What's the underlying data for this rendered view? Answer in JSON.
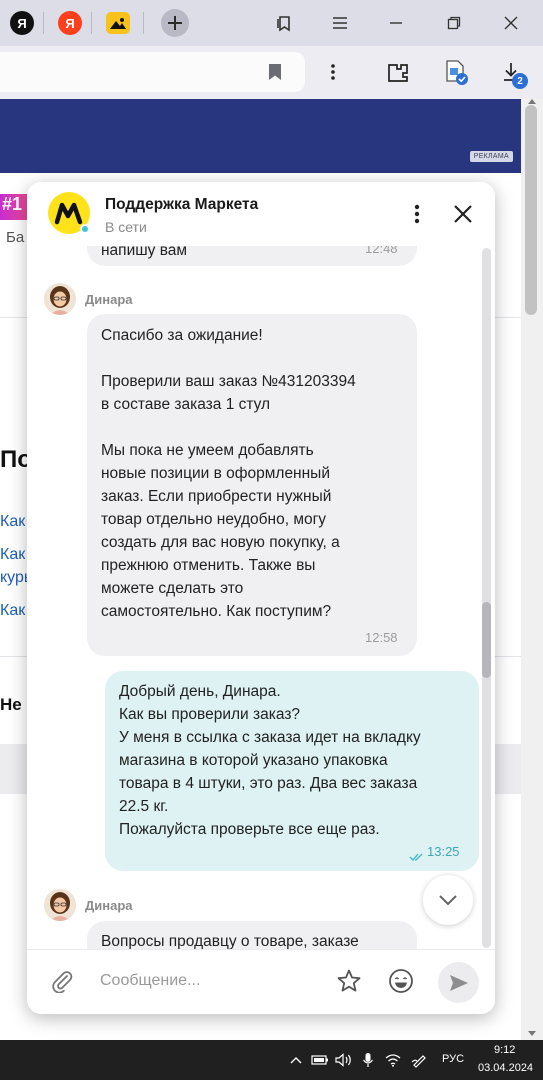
{
  "browser": {
    "tabs": [
      {
        "icon": "yandex-icon",
        "label": "Я",
        "bg": "#111111",
        "fg": "#ffffff"
      },
      {
        "icon": "yandex-browser-icon",
        "label": "Я",
        "bg": "#fc3f1d",
        "fg": "#ffffff"
      },
      {
        "icon": "image-icon",
        "label": "",
        "bg": "#f7c21a",
        "fg": "#000000"
      }
    ]
  },
  "chat": {
    "title": "Поддержка Маркета",
    "status": "В сети",
    "input_placeholder": "Сообщение...",
    "messages": [
      {
        "direction": "in",
        "lines": [
          "напишу вам"
        ],
        "time": "12:48"
      },
      {
        "direction": "in",
        "sender": "Динара",
        "lines": [
          "Спасибо за ожидание!",
          "",
          "Проверили ваш заказ №431203394",
          "в составе заказа 1 стул",
          "",
          "Мы пока не умеем добавлять",
          "новые позиции в оформленный",
          "заказ. Если приобрести нужный",
          "товар отдельно неудобно, могу",
          "создать для вас новую покупку, а",
          "прежнюю отменить. Также вы",
          "можете сделать это",
          "самостоятельно. Как поступим?"
        ],
        "time": "12:58"
      },
      {
        "direction": "out",
        "lines": [
          "Добрый день, Динара.",
          "Как вы проверили заказ?",
          "У меня в ссылка с заказа идет на вкладку",
          "магазина в которой указано упаковка",
          "товара в 4 штуки, это раз. Два вес заказа",
          "22.5 кг.",
          "Пожалуйста проверьте все еще раз."
        ],
        "time": "13:25",
        "read": true
      },
      {
        "direction": "in",
        "sender": "Динара",
        "lines": [
          "Вопросы продавцу о товаре, заказе"
        ]
      }
    ]
  },
  "page": {
    "ad_label": "РЕКЛАМА",
    "promo_chip": "1",
    "fragments": [
      "Ба",
      "По",
      "Как",
      "Как",
      "курь",
      "Как",
      "Не"
    ]
  },
  "taskbar": {
    "language": "РУС",
    "time": "9:12",
    "date": "03.04.2024"
  },
  "toolbar": {
    "downloads_badge": "2"
  },
  "colors": {
    "accent_brand": "#ffe21a",
    "banner": "#28357f",
    "outgoing_bubble": "#def2f3",
    "incoming_bubble": "#f0f0f3",
    "read_check": "#3bb7c9"
  }
}
